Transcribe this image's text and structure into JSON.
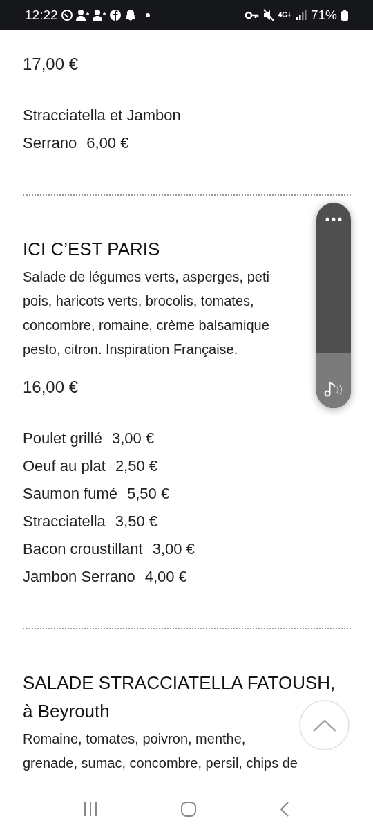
{
  "status_bar": {
    "time": "12:22",
    "network": "4G+",
    "battery": "71%"
  },
  "dishes": [
    {
      "price": "17,00 €",
      "extras": [
        {
          "name_lines": [
            "Stracciatella et Jambon",
            "Serrano"
          ],
          "price": "6,00 €"
        }
      ]
    },
    {
      "title_lines": [
        "ICI C’EST PARIS"
      ],
      "description_lines": [
        "Salade de légumes verts, asperges, peti",
        "pois, haricots verts, brocolis, tomates,",
        "concombre, romaine, crème balsamique",
        "pesto, citron. Inspiration Française."
      ],
      "price": "16,00 €",
      "extras": [
        {
          "name_lines": [
            "Poulet grillé"
          ],
          "price": "3,00 €"
        },
        {
          "name_lines": [
            "Oeuf au plat"
          ],
          "price": "2,50 €"
        },
        {
          "name_lines": [
            "Saumon fumé"
          ],
          "price": "5,50 €"
        },
        {
          "name_lines": [
            "Stracciatella"
          ],
          "price": "3,50 €"
        },
        {
          "name_lines": [
            "Bacon croustillant"
          ],
          "price": "3,00 €"
        },
        {
          "name_lines": [
            "Jambon Serrano"
          ],
          "price": "4,00 €"
        }
      ]
    },
    {
      "title_lines": [
        "SALADE STRACCIATELLA FATOUSH,",
        "à Beyrouth"
      ],
      "description_lines": [
        "Romaine, tomates, poivron, menthe,",
        "grenade, sumac, concombre, persil, chips de"
      ]
    }
  ],
  "sound_panel": {
    "level": 0.27
  }
}
